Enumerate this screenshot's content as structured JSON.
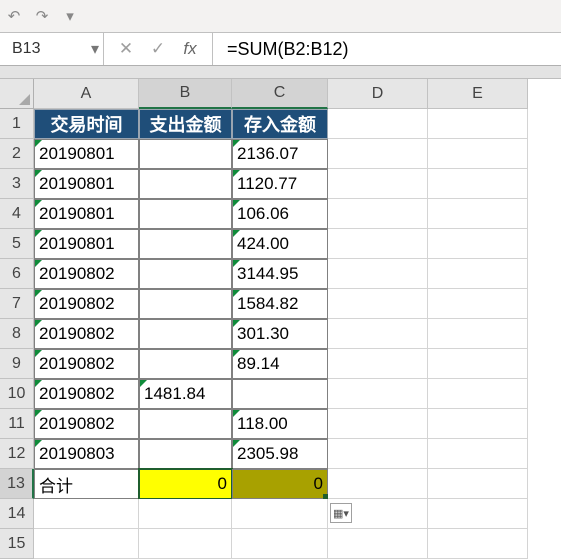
{
  "toolbar": {
    "undo_icon": "↶",
    "redo_icon": "↷",
    "dropdown_icon": "▾"
  },
  "name_box": {
    "value": "B13",
    "dropdown": "▾"
  },
  "formula_bar": {
    "cancel": "✕",
    "enter": "✓",
    "fx": "fx",
    "value": "=SUM(B2:B12)"
  },
  "columns": [
    "A",
    "B",
    "C",
    "D",
    "E"
  ],
  "rows": [
    "1",
    "2",
    "3",
    "4",
    "5",
    "6",
    "7",
    "8",
    "9",
    "10",
    "11",
    "12",
    "13",
    "14",
    "15"
  ],
  "headers": {
    "a": "交易时间",
    "b": "支出金额",
    "c": "存入金额"
  },
  "data": [
    {
      "a": "20190801",
      "b": "",
      "c": "2136.07"
    },
    {
      "a": "20190801",
      "b": "",
      "c": "1120.77"
    },
    {
      "a": "20190801",
      "b": "",
      "c": "106.06"
    },
    {
      "a": "20190801",
      "b": "",
      "c": "424.00"
    },
    {
      "a": "20190802",
      "b": "",
      "c": "3144.95"
    },
    {
      "a": "20190802",
      "b": "",
      "c": "1584.82"
    },
    {
      "a": "20190802",
      "b": "",
      "c": "301.30"
    },
    {
      "a": "20190802",
      "b": "",
      "c": "89.14"
    },
    {
      "a": "20190802",
      "b": "1481.84",
      "c": ""
    },
    {
      "a": "20190802",
      "b": "",
      "c": "118.00"
    },
    {
      "a": "20190803",
      "b": "",
      "c": "2305.98"
    }
  ],
  "totals": {
    "label": "合计",
    "b": "0",
    "c": "0"
  },
  "autofill_icon": "▦▾"
}
